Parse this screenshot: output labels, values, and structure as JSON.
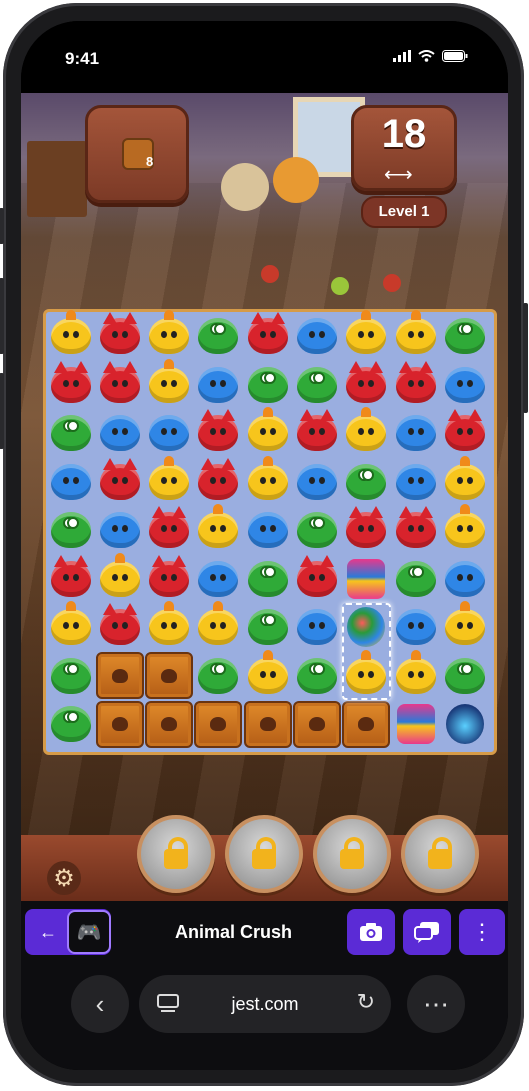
{
  "status_bar": {
    "time": "9:41"
  },
  "game": {
    "goal": {
      "item": "paw-crate",
      "count": "8"
    },
    "moves": {
      "value": "18",
      "icon": "swap-arrows-icon"
    },
    "level_label": "Level 1",
    "board": {
      "rows": 9,
      "cols": 9,
      "legend": {
        "C": "yellow-chick",
        "R": "red-cat",
        "B": "blue-blob",
        "F": "green-frog",
        "W": "paw-crate",
        "L": "lantern-booster",
        "G": "gumball-booster",
        "S": "bomb-booster",
        "_": "empty"
      },
      "grid": [
        [
          "C",
          "R",
          "C",
          "F",
          "R",
          "B",
          "C",
          "C",
          "F"
        ],
        [
          "R",
          "R",
          "C",
          "B",
          "F",
          "F",
          "R",
          "R",
          "B"
        ],
        [
          "F",
          "B",
          "B",
          "R",
          "C",
          "R",
          "C",
          "B",
          "R"
        ],
        [
          "B",
          "R",
          "C",
          "R",
          "C",
          "B",
          "F",
          "B",
          "C"
        ],
        [
          "F",
          "B",
          "R",
          "C",
          "B",
          "F",
          "R",
          "R",
          "C"
        ],
        [
          "R",
          "C",
          "R",
          "B",
          "F",
          "R",
          "L",
          "F",
          "B"
        ],
        [
          "C",
          "R",
          "C",
          "C",
          "F",
          "B",
          "G",
          "B",
          "C"
        ],
        [
          "F",
          "W",
          "W",
          "F",
          "C",
          "F",
          "C",
          "C",
          "F"
        ],
        [
          "F",
          "W",
          "W",
          "W",
          "W",
          "W",
          "W",
          "L",
          "S"
        ]
      ],
      "selected_cells": [
        [
          6,
          6
        ],
        [
          7,
          6
        ]
      ]
    },
    "booster_slots": [
      {
        "state": "locked",
        "icon": "lock-icon"
      },
      {
        "state": "locked",
        "icon": "lock-icon"
      },
      {
        "state": "locked",
        "icon": "lock-icon"
      },
      {
        "state": "locked",
        "icon": "lock-icon"
      }
    ],
    "settings_icon": "gear-icon"
  },
  "jest_bar": {
    "back_icon": "arrow-left-icon",
    "game_icon": "gamepad-icon",
    "title": "Animal Crush",
    "camera_icon": "camera-icon",
    "chat_icon": "chat-icon",
    "more_icon": "more-vertical-icon"
  },
  "browser": {
    "url": "jest.com",
    "back_icon": "chevron-left-icon",
    "tabs_icon": "page-icon",
    "reload_icon": "reload-icon",
    "menu_icon": "more-horizontal-icon"
  },
  "colors": {
    "yellow-chick": "#f7c51c",
    "red-cat": "#d8232c",
    "blue-blob": "#2f86e6",
    "green-frog": "#2faa38",
    "accent": "#5b2bd6",
    "board": "#9aaee0"
  }
}
